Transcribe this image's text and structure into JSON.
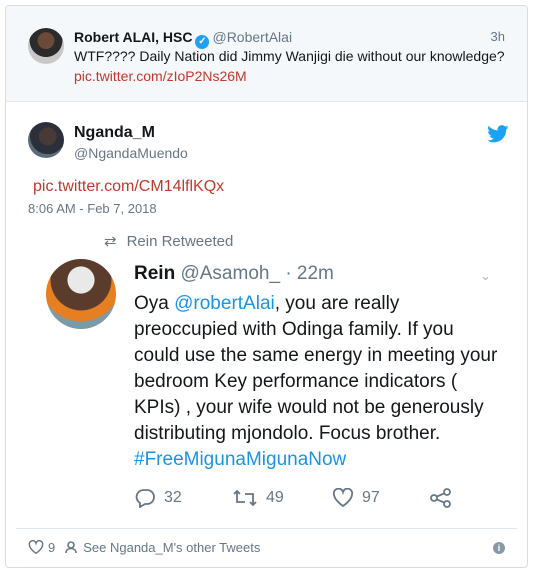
{
  "quoted_tweet": {
    "name": "Robert ALAI, HSC",
    "handle": "@RobertAlai",
    "time": "3h",
    "text": "WTF???? Daily Nation did Jimmy Wanjigi die without our knowledge?",
    "link": "pic.twitter.com/zIoP2Ns26M"
  },
  "tweet": {
    "name": "Nganda_M",
    "handle": "@NgandaMuendo",
    "link": "pic.twitter.com/CM14lflKQx",
    "date": "8:06 AM - Feb 7, 2018",
    "like_count": "9",
    "other_tweets": "See Nganda_M's other Tweets"
  },
  "retweet_image": {
    "retweeted_label": "Rein Retweeted",
    "name": "Rein",
    "handle": "@Asamoh_",
    "time": "· 22m",
    "text_before": "Oya ",
    "mention": "@robertAlai",
    "text_middle": ", you are really preoccupied with Odinga family. If you could use the same energy in meeting your bedroom Key performance indicators ( KPIs) , your wife would not be generously distributing mjondolo. Focus brother. ",
    "hashtag": "#FreeMigunaMigunaNow",
    "replies": "32",
    "retweets": "49",
    "likes": "97"
  },
  "colors": {
    "link_red": "#c0392b",
    "twitter_blue": "#1da1f2",
    "muted": "#657786"
  },
  "icons": [
    "verified-badge-icon",
    "twitter-bird-icon",
    "retweet-icon",
    "chevron-down-icon",
    "reply-icon",
    "like-icon",
    "share-icon",
    "heart-icon",
    "info-icon"
  ]
}
